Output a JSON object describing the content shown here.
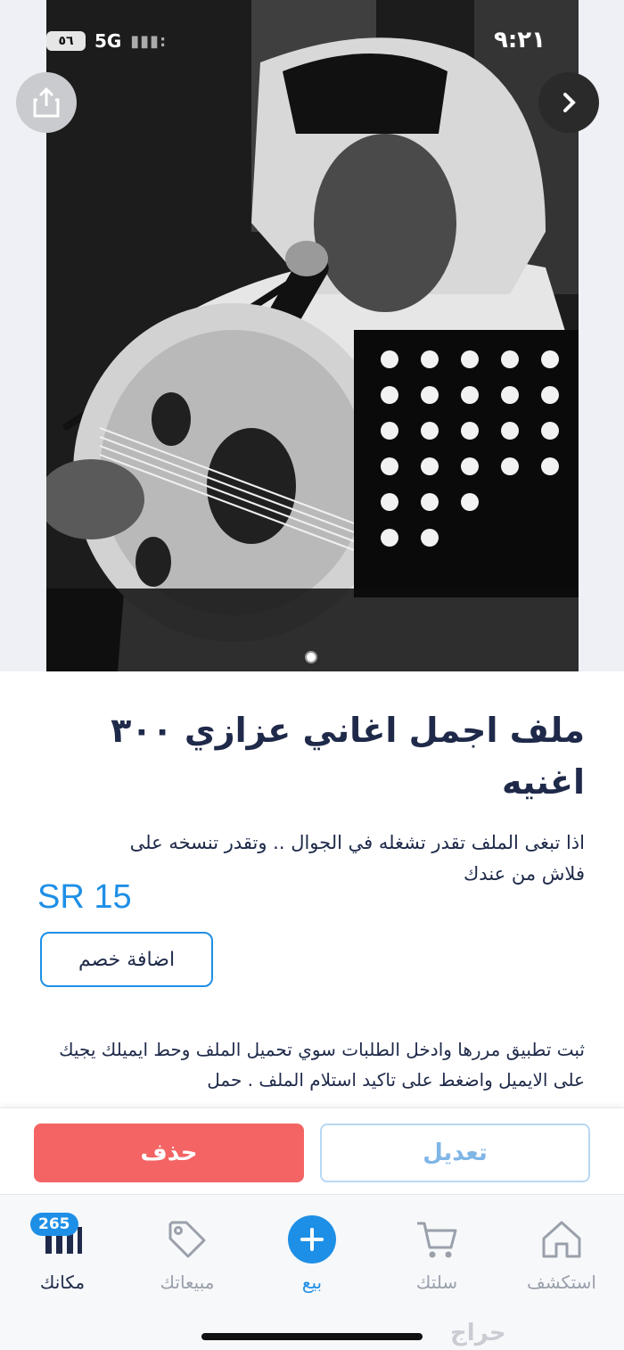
{
  "status_bar": {
    "time": "٩:٢١",
    "network": "5G",
    "battery": "٥٦"
  },
  "gallery": {
    "pages": 1,
    "current": 1
  },
  "listing": {
    "title": "ملف اجمل اغاني عزازي ٣٠٠ اغنيه",
    "description": "اذا تبغى الملف تقدر تشغله في الجوال .. وتقدر تنسخه على فلاش من عندك",
    "price": "SR 15",
    "discount_button": "اضافة خصم",
    "details": "ثبت تطبيق مررها وادخل الطلبات سوي تحميل الملف وحط ايميلك يجيك على الايميل واضغط على تاكيد استلام الملف . حمل"
  },
  "actions": {
    "delete_label": "حذف",
    "edit_label": "تعديل"
  },
  "nav": {
    "explore": "استكشف",
    "cart": "سلتك",
    "sell": "بيع",
    "sales": "مبيعاتك",
    "my_place": "مكانك",
    "badge_count": "265"
  },
  "watermark": "حراج",
  "colors": {
    "accent": "#1e8fe6",
    "delete": "#f46464",
    "text": "#1f2a4a"
  }
}
